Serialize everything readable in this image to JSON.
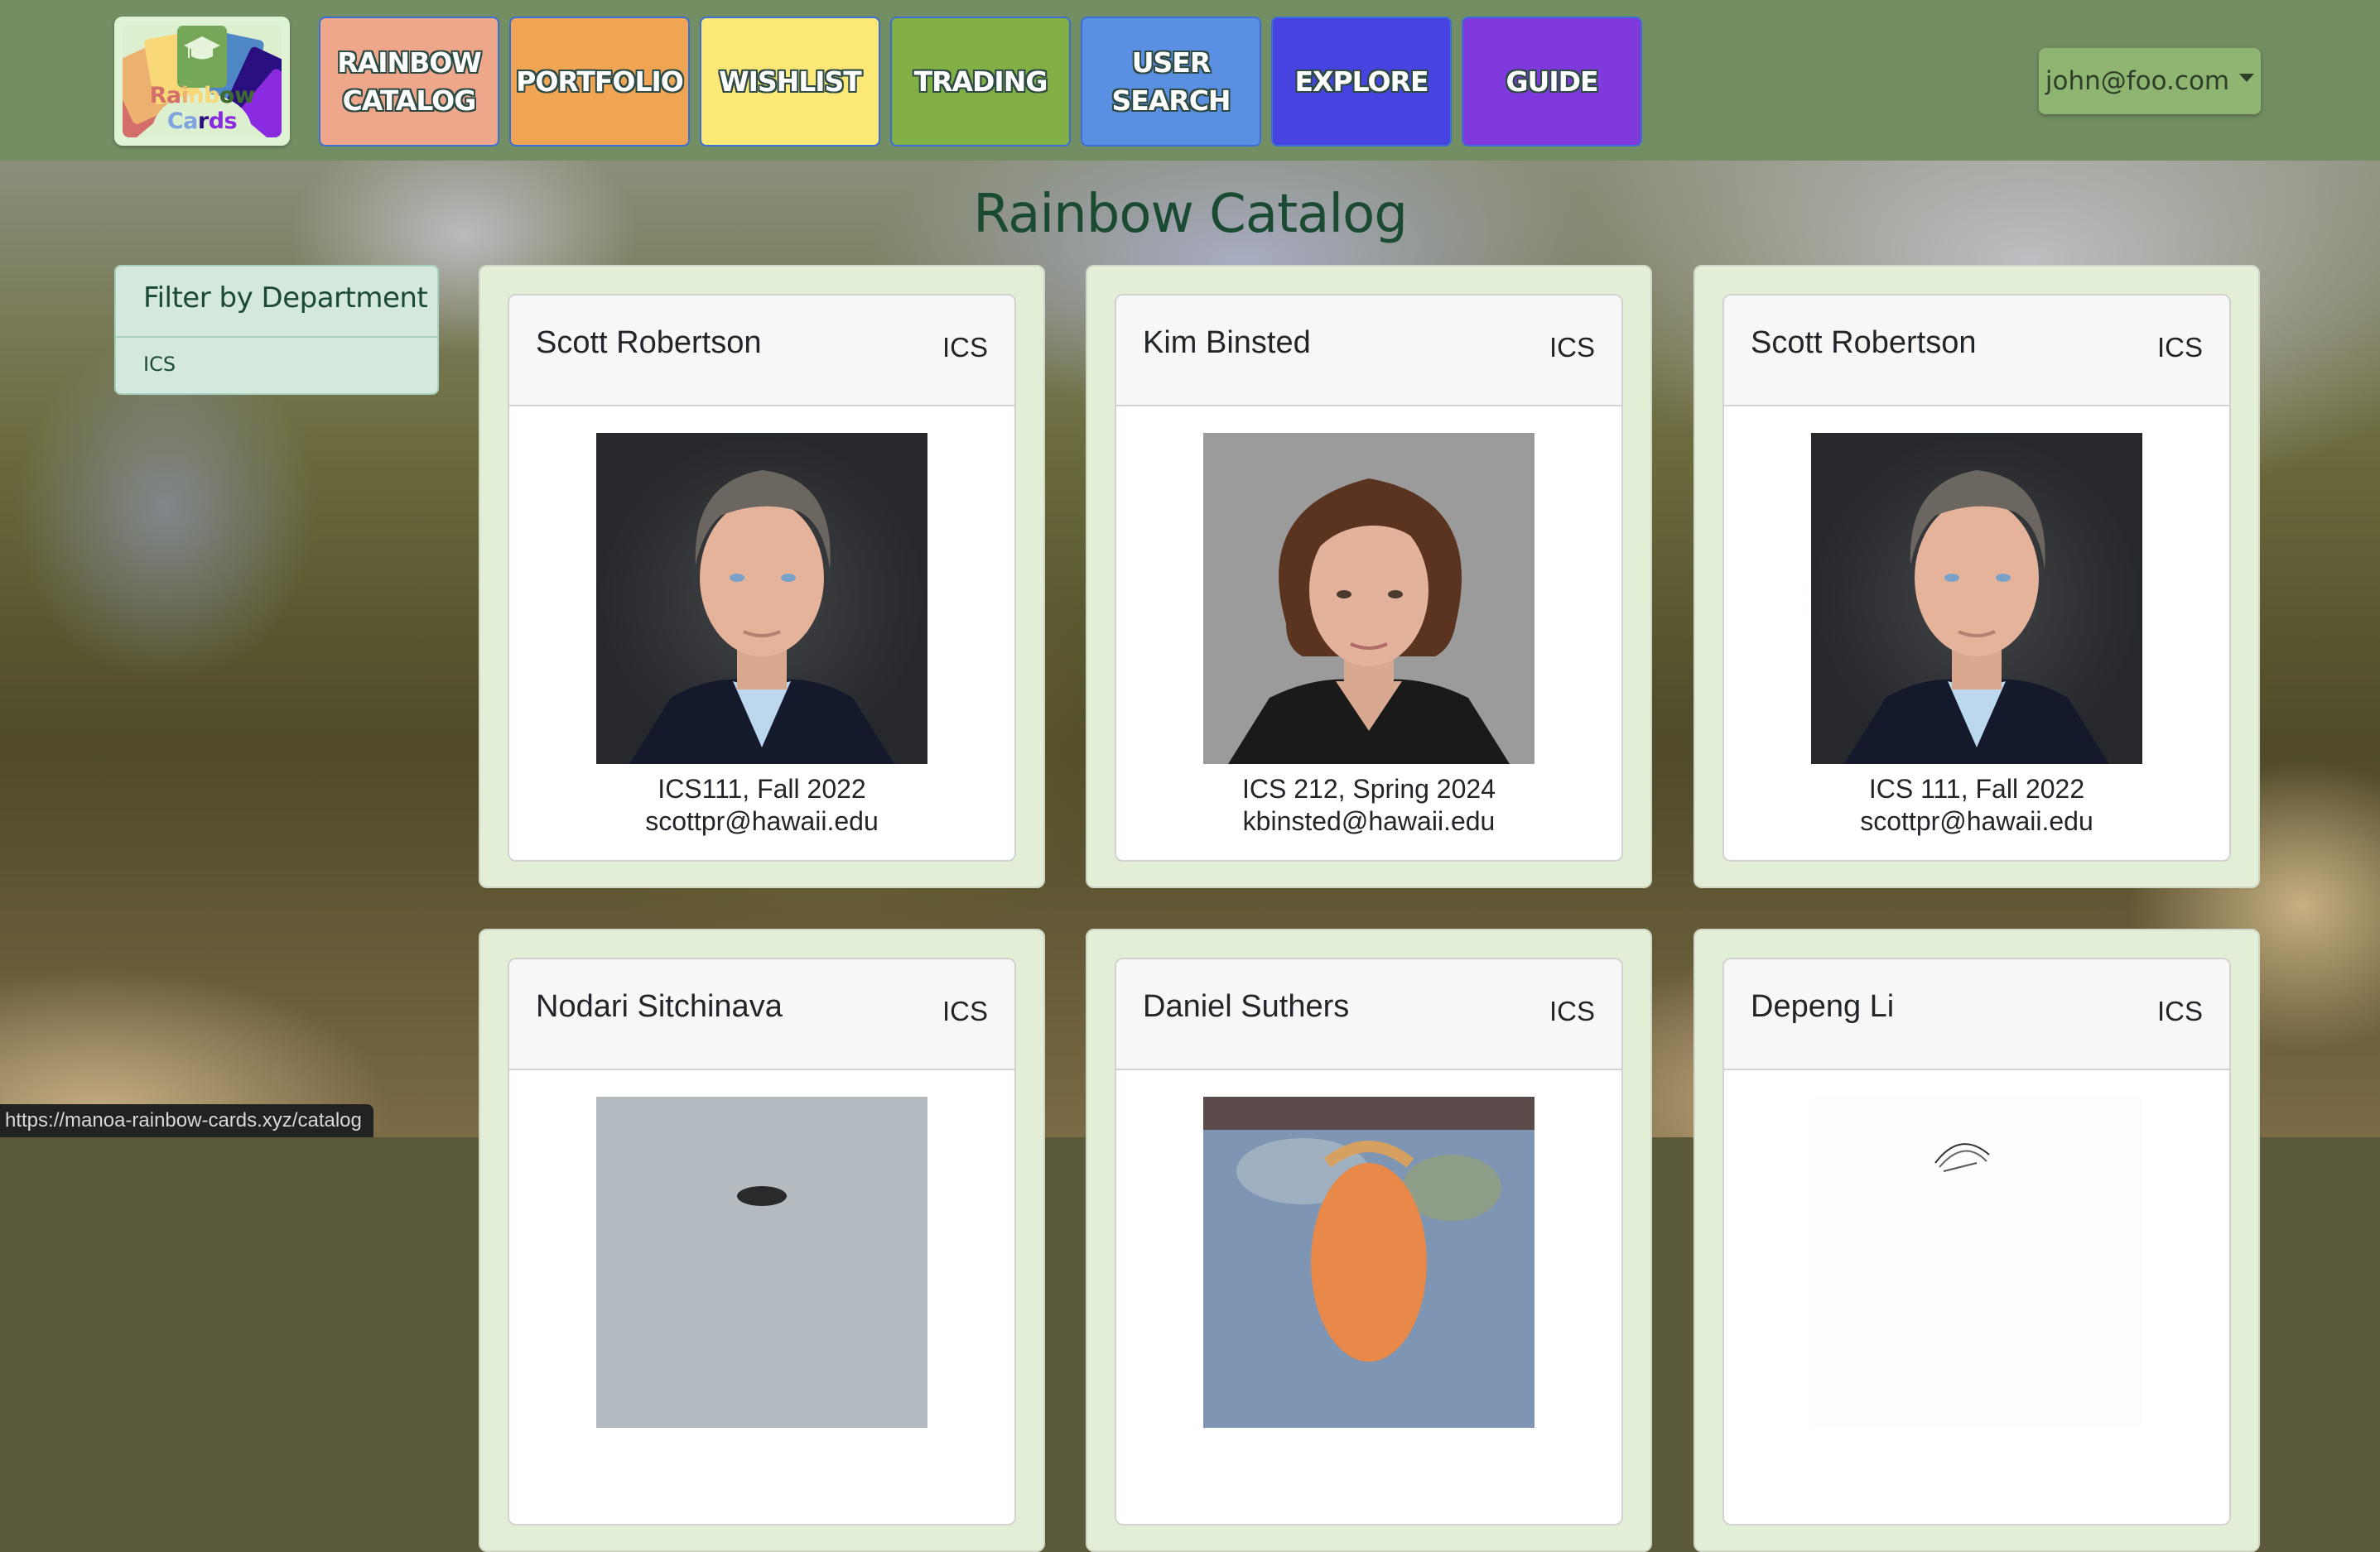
{
  "navbar": {
    "logo": {
      "text_parts": [
        "Ra",
        "i",
        "n",
        "b",
        "ow",
        " ",
        "C",
        "a",
        "r",
        "ds"
      ],
      "alt": "Rainbow Cards"
    },
    "items": [
      {
        "label": "RAINBOW\nCATALOG",
        "line1": "RAINBOW",
        "line2": "CATALOG",
        "color": "#eea78a"
      },
      {
        "label": "PORTFOLIO",
        "line1": "PORTFOLIO",
        "line2": "",
        "color": "#f0a555"
      },
      {
        "label": "WISHLIST",
        "line1": "WISHLIST",
        "line2": "",
        "color": "#fce877"
      },
      {
        "label": "TRADING",
        "line1": "TRADING",
        "line2": "",
        "color": "#82b046"
      },
      {
        "label": "USER\nSEARCH",
        "line1": "USER",
        "line2": "SEARCH",
        "color": "#5b8fe2"
      },
      {
        "label": "EXPLORE",
        "line1": "EXPLORE",
        "line2": "",
        "color": "#4643e1"
      },
      {
        "label": "GUIDE",
        "line1": "GUIDE",
        "line2": "",
        "color": "#8039dc"
      }
    ],
    "user_menu": {
      "label": "john@foo.com"
    }
  },
  "page": {
    "title": "Rainbow Catalog"
  },
  "filter": {
    "title": "Filter by Department",
    "options": [
      "ICS"
    ]
  },
  "cards": [
    {
      "name": "Scott Robertson",
      "department": "ICS",
      "course": "ICS111, Fall 2022",
      "email": "scottpr@hawaii.edu",
      "photo": "male-professor-portrait"
    },
    {
      "name": "Kim Binsted",
      "department": "ICS",
      "course": "ICS 212, Spring 2024",
      "email": "kbinsted@hawaii.edu",
      "photo": "female-professor-portrait"
    },
    {
      "name": "Scott Robertson",
      "department": "ICS",
      "course": "ICS 111, Fall 2022",
      "email": "scottpr@hawaii.edu",
      "photo": "male-professor-portrait"
    },
    {
      "name": "Nodari Sitchinava",
      "department": "ICS",
      "course": "",
      "email": "",
      "photo": "portrait-gray-background"
    },
    {
      "name": "Daniel Suthers",
      "department": "ICS",
      "course": "",
      "email": "",
      "photo": "painted-portrait"
    },
    {
      "name": "Depeng Li",
      "department": "ICS",
      "course": "",
      "email": "",
      "photo": "sketch-portrait"
    }
  ],
  "status_bar": {
    "url": "https://manoa-rainbow-cards.xyz/catalog"
  },
  "colors": {
    "navbar_bg": "#748e64",
    "title_text": "#1b4a32",
    "card_outer_bg": "#e2eed6",
    "filter_bg": "#d5e8de",
    "user_menu_bg": "#8eb672"
  }
}
